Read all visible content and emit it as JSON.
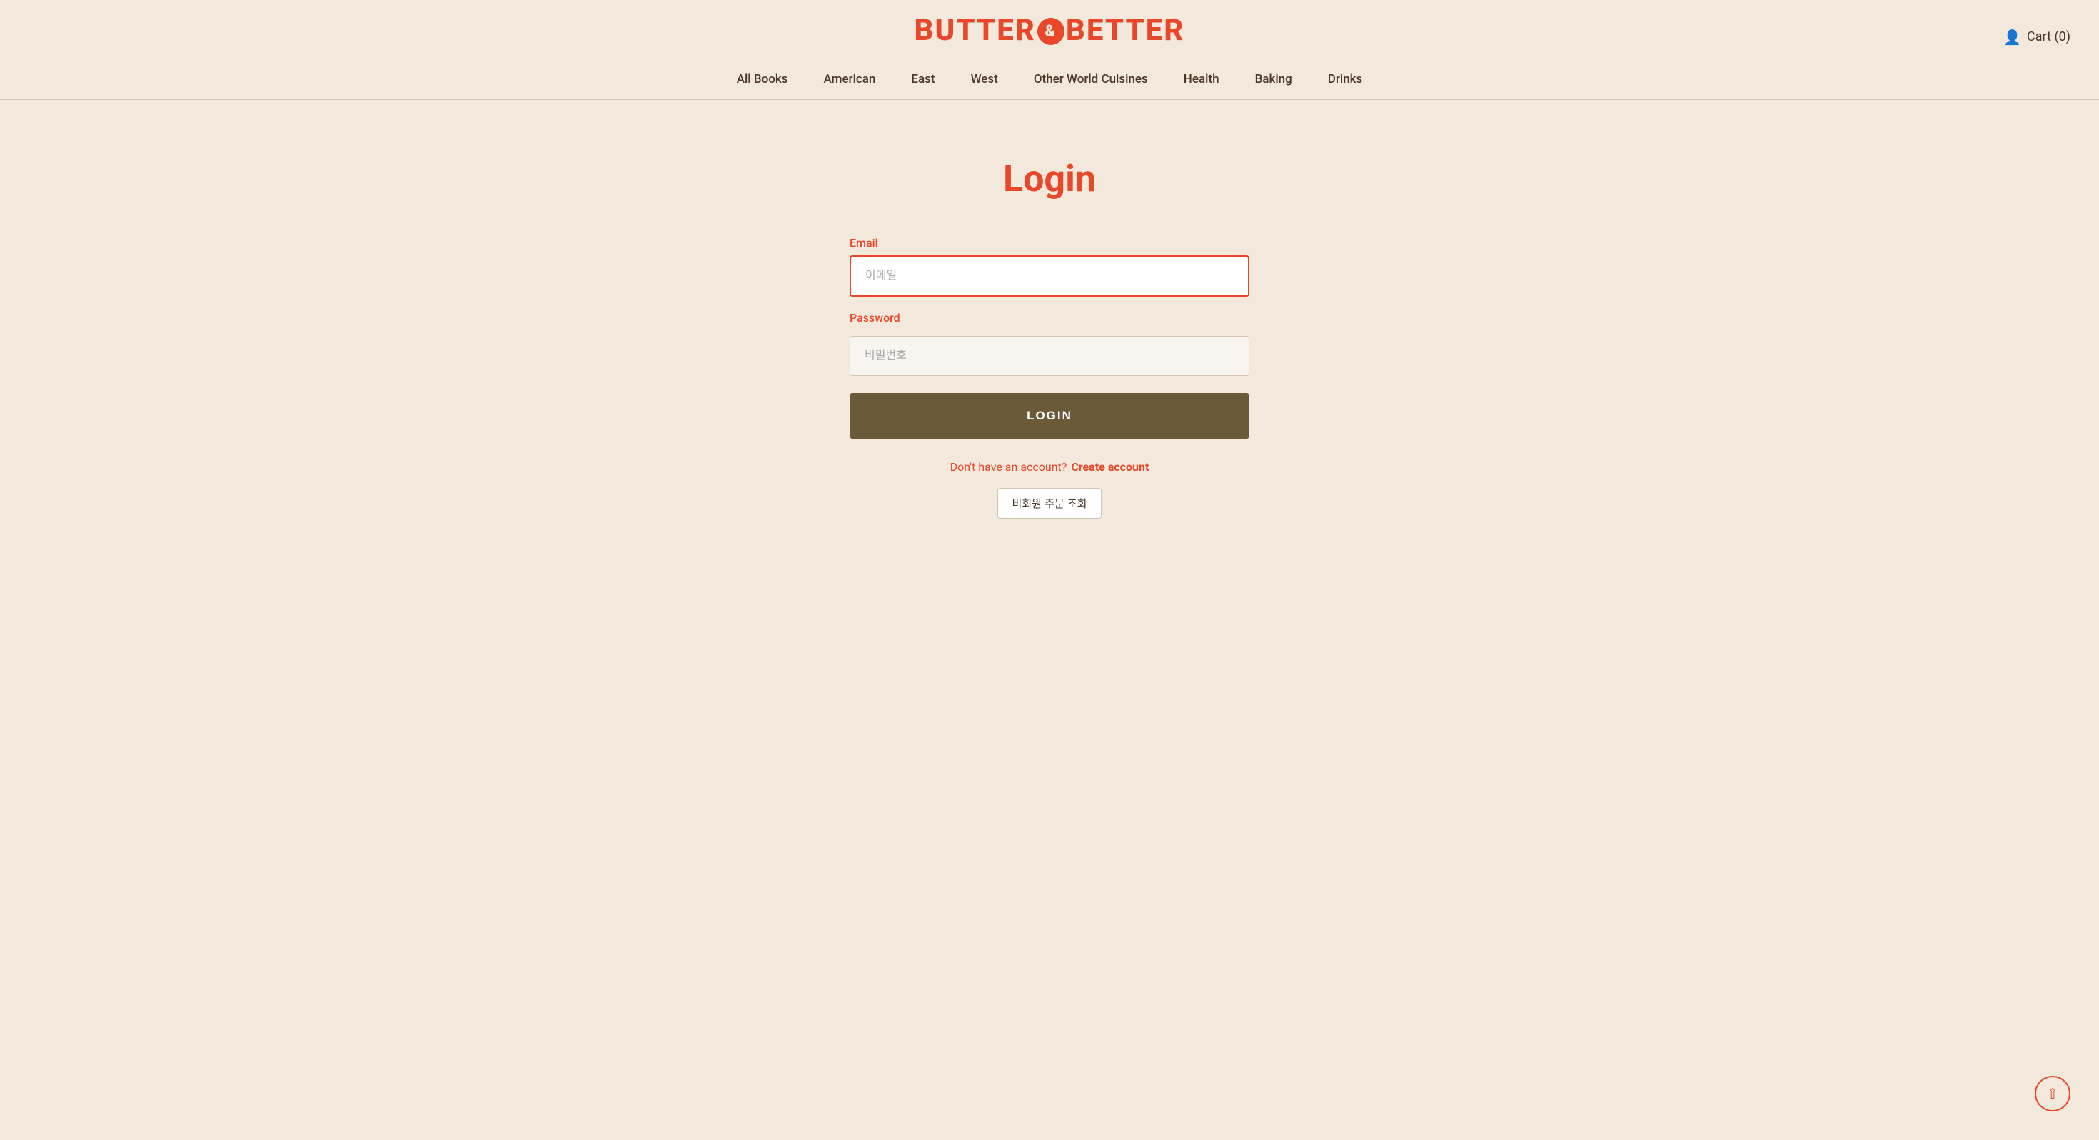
{
  "header": {
    "logo_text_before": "BUTTER",
    "logo_text_after": "BETTER",
    "cart_label": "Cart (0)"
  },
  "nav": {
    "items": [
      {
        "id": "all-books",
        "label": "All Books"
      },
      {
        "id": "american",
        "label": "American"
      },
      {
        "id": "east",
        "label": "East"
      },
      {
        "id": "west",
        "label": "West"
      },
      {
        "id": "other-world-cuisines",
        "label": "Other World Cuisines"
      },
      {
        "id": "health",
        "label": "Health"
      },
      {
        "id": "baking",
        "label": "Baking"
      },
      {
        "id": "drinks",
        "label": "Drinks"
      }
    ]
  },
  "main": {
    "page_title": "Login",
    "email_label": "Email",
    "email_placeholder": "이메일",
    "password_label": "Password",
    "password_placeholder": "비밀번호",
    "login_button_label": "LOGIN",
    "no_account_text": "Don't have an account?",
    "create_account_label": "Create account",
    "guest_order_label": "비회원 주문 조회"
  },
  "colors": {
    "brand_red": "#e8472a",
    "brand_brown": "#6b5a3a",
    "bg": "#f2e8dc",
    "text_dark": "#4a3728"
  }
}
